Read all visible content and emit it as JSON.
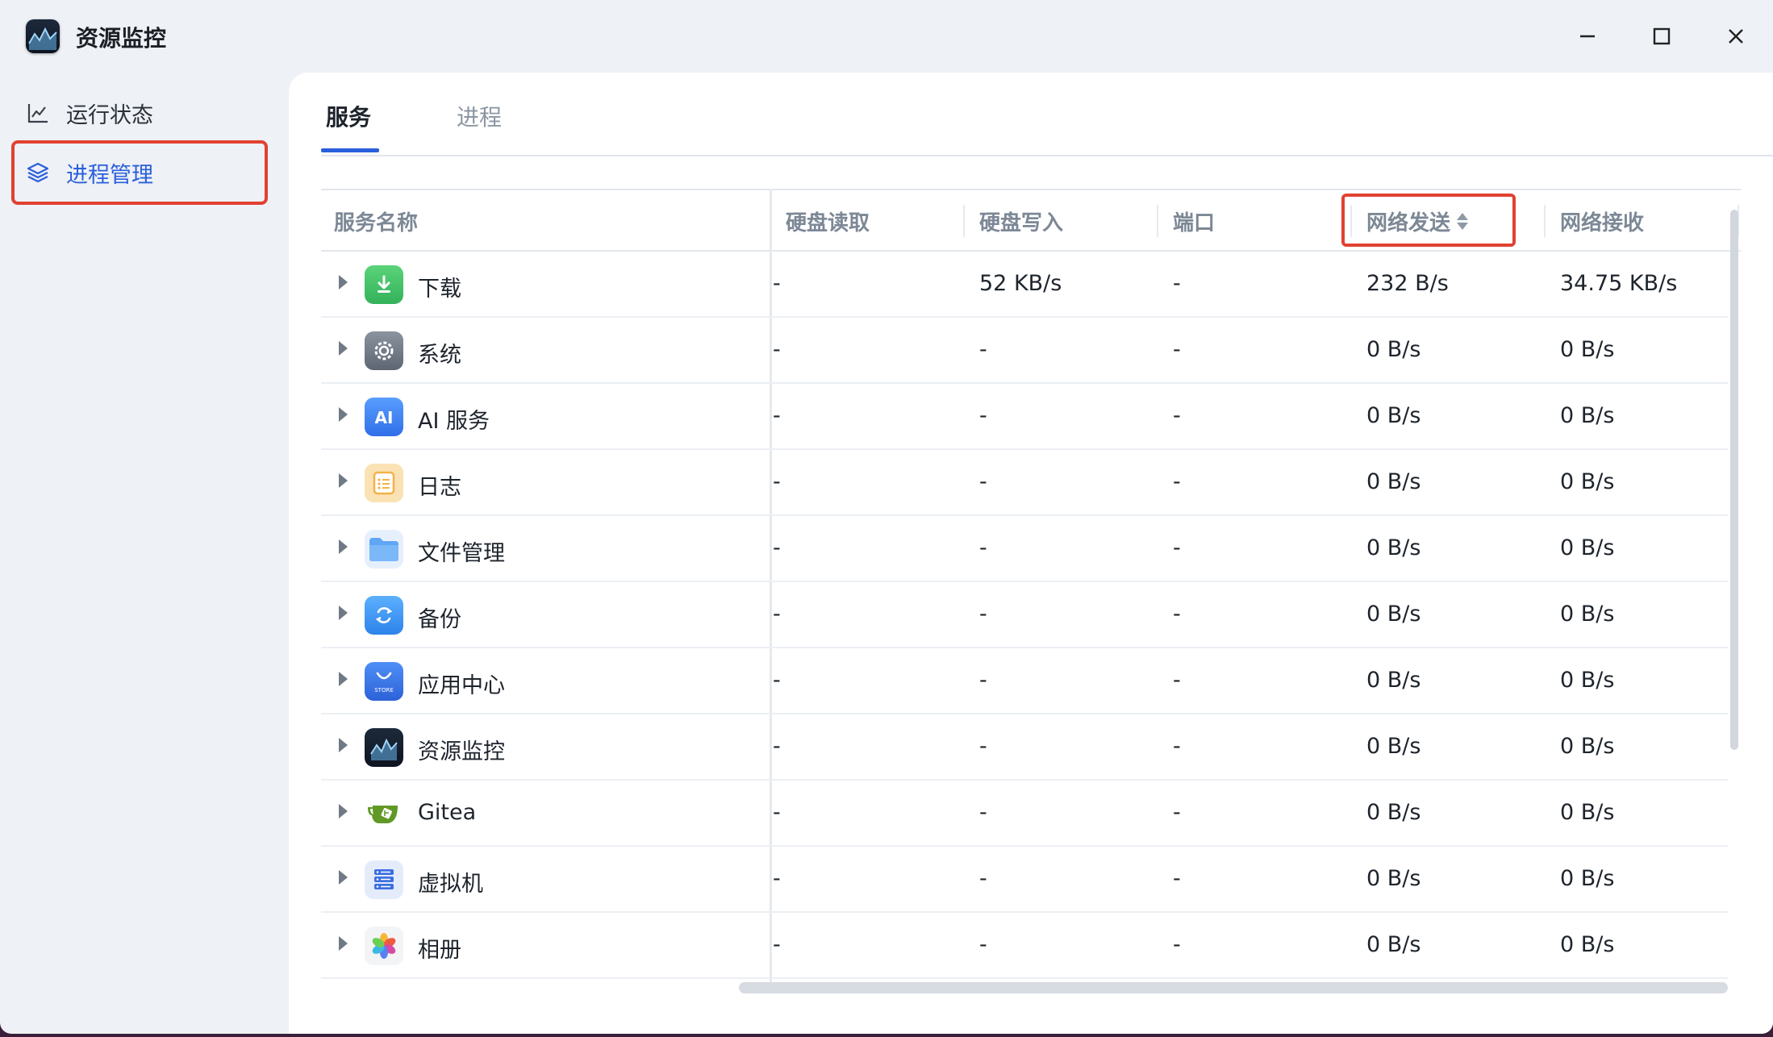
{
  "window": {
    "title": "资源监控"
  },
  "sidebar": {
    "items": [
      {
        "label": "运行状态",
        "icon": "line-chart-icon"
      },
      {
        "label": "进程管理",
        "icon": "layers-icon"
      }
    ]
  },
  "tabs": [
    {
      "label": "服务",
      "active": true
    },
    {
      "label": "进程",
      "active": false
    }
  ],
  "table": {
    "columns": [
      "服务名称",
      "硬盘读取",
      "硬盘写入",
      "端口",
      "网络发送",
      "网络接收"
    ],
    "rows": [
      {
        "name": "下载",
        "icon": "download-app-icon",
        "disk_read": "-",
        "disk_write": "52 KB/s",
        "port": "-",
        "net_send": "232 B/s",
        "net_recv": "34.75 KB/s"
      },
      {
        "name": "系统",
        "icon": "system-gear-icon",
        "disk_read": "-",
        "disk_write": "-",
        "port": "-",
        "net_send": "0 B/s",
        "net_recv": "0 B/s"
      },
      {
        "name": "AI 服务",
        "icon": "ai-service-icon",
        "disk_read": "-",
        "disk_write": "-",
        "port": "-",
        "net_send": "0 B/s",
        "net_recv": "0 B/s"
      },
      {
        "name": "日志",
        "icon": "log-icon",
        "disk_read": "-",
        "disk_write": "-",
        "port": "-",
        "net_send": "0 B/s",
        "net_recv": "0 B/s"
      },
      {
        "name": "文件管理",
        "icon": "folder-icon",
        "disk_read": "-",
        "disk_write": "-",
        "port": "-",
        "net_send": "0 B/s",
        "net_recv": "0 B/s"
      },
      {
        "name": "备份",
        "icon": "backup-icon",
        "disk_read": "-",
        "disk_write": "-",
        "port": "-",
        "net_send": "0 B/s",
        "net_recv": "0 B/s"
      },
      {
        "name": "应用中心",
        "icon": "app-store-icon",
        "icon_text": "STORE",
        "disk_read": "-",
        "disk_write": "-",
        "port": "-",
        "net_send": "0 B/s",
        "net_recv": "0 B/s"
      },
      {
        "name": "资源监控",
        "icon": "resource-monitor-icon",
        "disk_read": "-",
        "disk_write": "-",
        "port": "-",
        "net_send": "0 B/s",
        "net_recv": "0 B/s"
      },
      {
        "name": "Gitea",
        "icon": "gitea-icon",
        "disk_read": "-",
        "disk_write": "-",
        "port": "-",
        "net_send": "0 B/s",
        "net_recv": "0 B/s"
      },
      {
        "name": "虚拟机",
        "icon": "virtual-machine-icon",
        "disk_read": "-",
        "disk_write": "-",
        "port": "-",
        "net_send": "0 B/s",
        "net_recv": "0 B/s"
      },
      {
        "name": "相册",
        "icon": "photos-icon",
        "disk_read": "-",
        "disk_write": "-",
        "port": "-",
        "net_send": "0 B/s",
        "net_recv": "0 B/s"
      }
    ]
  },
  "colors": {
    "accent": "#2a5fdc",
    "highlight_box": "#e14132",
    "window_bg": "#eef1f5",
    "panel_bg": "#ffffff"
  }
}
